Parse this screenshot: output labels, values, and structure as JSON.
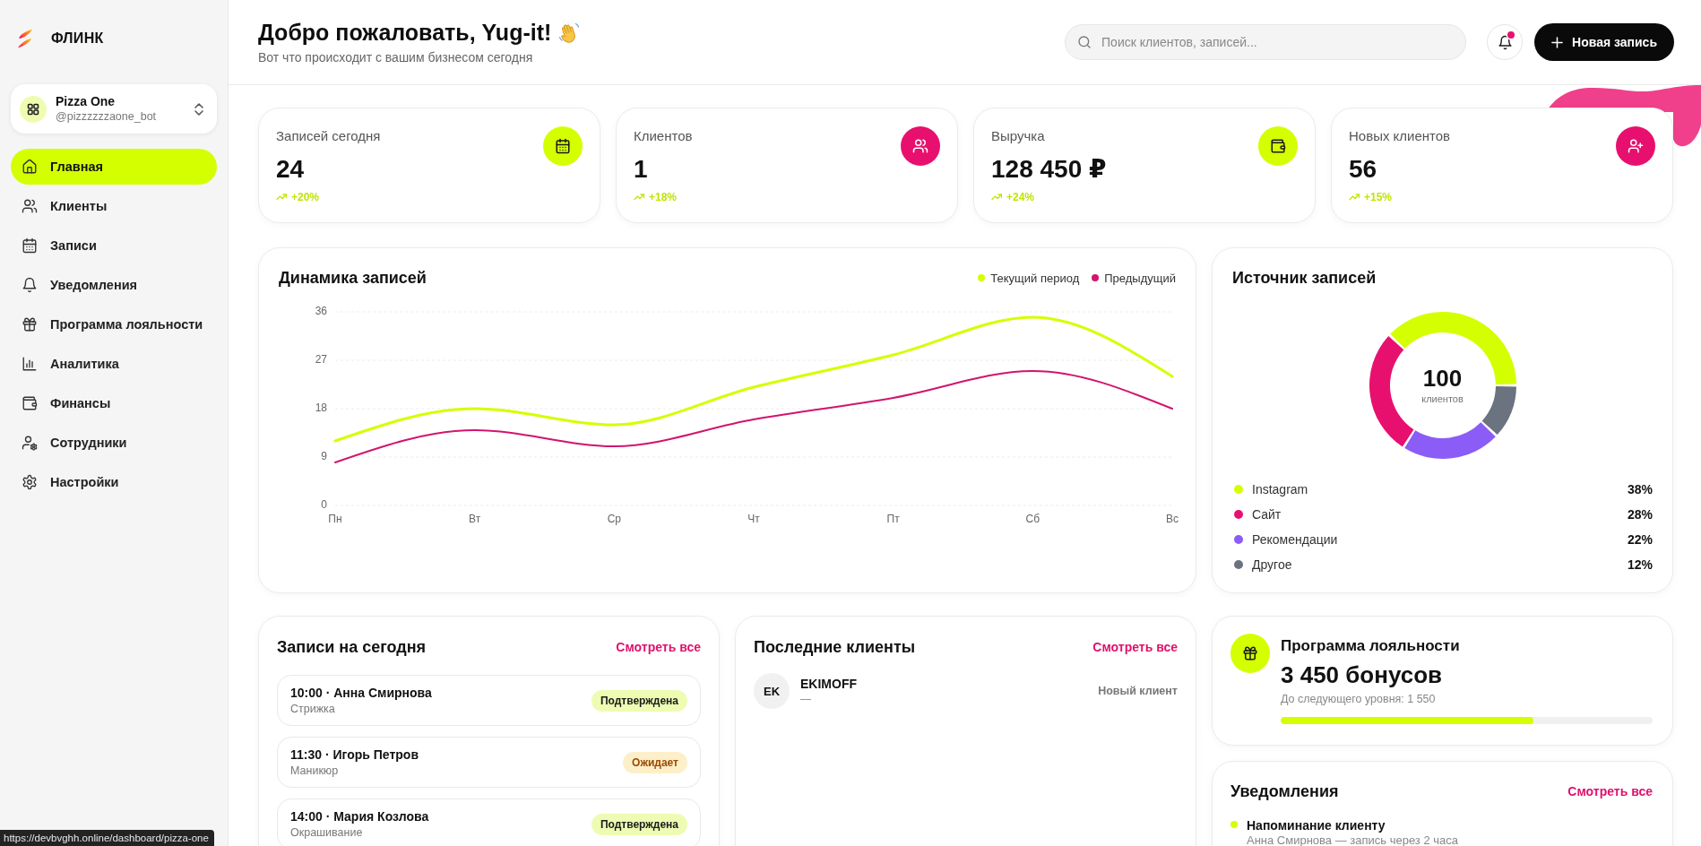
{
  "sidebar": {
    "logo": "ФЛИНК",
    "workspace": {
      "name": "Pizza One",
      "handle": "@pizzzzzzaone_bot"
    },
    "items": [
      {
        "label": "Главная",
        "selected": true
      },
      {
        "label": "Клиенты",
        "selected": false
      },
      {
        "label": "Записи",
        "selected": false
      },
      {
        "label": "Уведомления",
        "selected": false
      },
      {
        "label": "Программа лояльности",
        "selected": false
      },
      {
        "label": "Аналитика",
        "selected": false
      },
      {
        "label": "Финансы",
        "selected": false
      },
      {
        "label": "Сотрудники",
        "selected": false
      },
      {
        "label": "Настройки",
        "selected": false
      }
    ]
  },
  "header": {
    "title": "Добро пожаловать, Yug-it!",
    "subtitle": "Вот что происходит с вашим бизнесом сегодня",
    "search": {
      "placeholder": "Поиск клиентов, записей..."
    },
    "unread": true,
    "new_button": "Новая запись"
  },
  "stats": [
    {
      "label": "Записей сегодня",
      "value": "24",
      "trend": "+20%",
      "color": "#d4ff00"
    },
    {
      "label": "Клиентов",
      "value": "1",
      "trend": "+18%",
      "color": "#e8106e"
    },
    {
      "label": "Выручка",
      "value": "128 450 ₽",
      "trend": "+24%",
      "color": "#d4ff00"
    },
    {
      "label": "Новых клиентов",
      "value": "56",
      "trend": "+15%",
      "color": "#e8106e"
    }
  ],
  "dynamics": {
    "chart_data": {
      "type": "line",
      "title": "Динамика записей",
      "categories": [
        "Пн",
        "Вт",
        "Ср",
        "Чт",
        "Пт",
        "Сб",
        "Вс"
      ],
      "series": [
        {
          "name": "Текущий период",
          "color": "#d4ff00",
          "values": [
            12,
            18,
            15,
            22,
            28,
            35,
            24
          ]
        },
        {
          "name": "Предыдущий",
          "color": "#d1156d",
          "values": [
            8,
            14,
            11,
            16,
            20,
            25,
            18
          ]
        }
      ],
      "ylim": [
        0,
        36
      ],
      "yticks": [
        0,
        9,
        18,
        27,
        36
      ],
      "grid": true
    }
  },
  "sources": {
    "chart_data": {
      "type": "donut",
      "title": "Источник записей",
      "categories": [
        "Instagram",
        "Сайт",
        "Рекомендации",
        "Другое"
      ],
      "values": [
        38,
        28,
        22,
        12
      ]
    },
    "total": "100",
    "total_label": "клиентов",
    "legend": [
      {
        "value": "38%",
        "color": "#d4ff00"
      },
      {
        "value": "28%",
        "color": "#e8106e"
      },
      {
        "value": "22%",
        "color": "#8b5cf6"
      },
      {
        "value": "12%",
        "color": "#6b7280"
      }
    ]
  },
  "appointments": {
    "title": "Записи на сегодня",
    "link": "Смотреть все",
    "items": [
      {
        "title": "10:00 · Анна Смирнова",
        "service": "Стрижка",
        "badge": {
          "label": "Подтверждена",
          "kind": "confirmed"
        }
      },
      {
        "title": "11:30 · Игорь Петров",
        "service": "Маникюр",
        "badge": {
          "label": "Ожидает",
          "kind": "pending"
        }
      },
      {
        "title": "14:00 · Мария Козлова",
        "service": "Окрашивание",
        "badge": {
          "label": "Подтверждена",
          "kind": "confirmed"
        }
      }
    ]
  },
  "recent_clients": {
    "title": "Последние клиенты",
    "link": "Смотреть все",
    "items": [
      {
        "initials": "EK",
        "name": "EKIMOFF",
        "detail": "—",
        "tag": "Новый клиент"
      }
    ]
  },
  "loyalty": {
    "title": "Программа лояльности",
    "points": "3 450 бонусов",
    "next_level": "До следующего уровня: 1 550",
    "level": 0.68
  },
  "notifications": {
    "title": "Уведомления",
    "link": "Смотреть все",
    "items": [
      {
        "title": "Напоминание клиенту",
        "text": "Анна Смирнова — запись через 2 часа",
        "color": "#d4ff00"
      }
    ]
  },
  "browser_status": "https://devbvghh.online/dashboard/pizza-one"
}
